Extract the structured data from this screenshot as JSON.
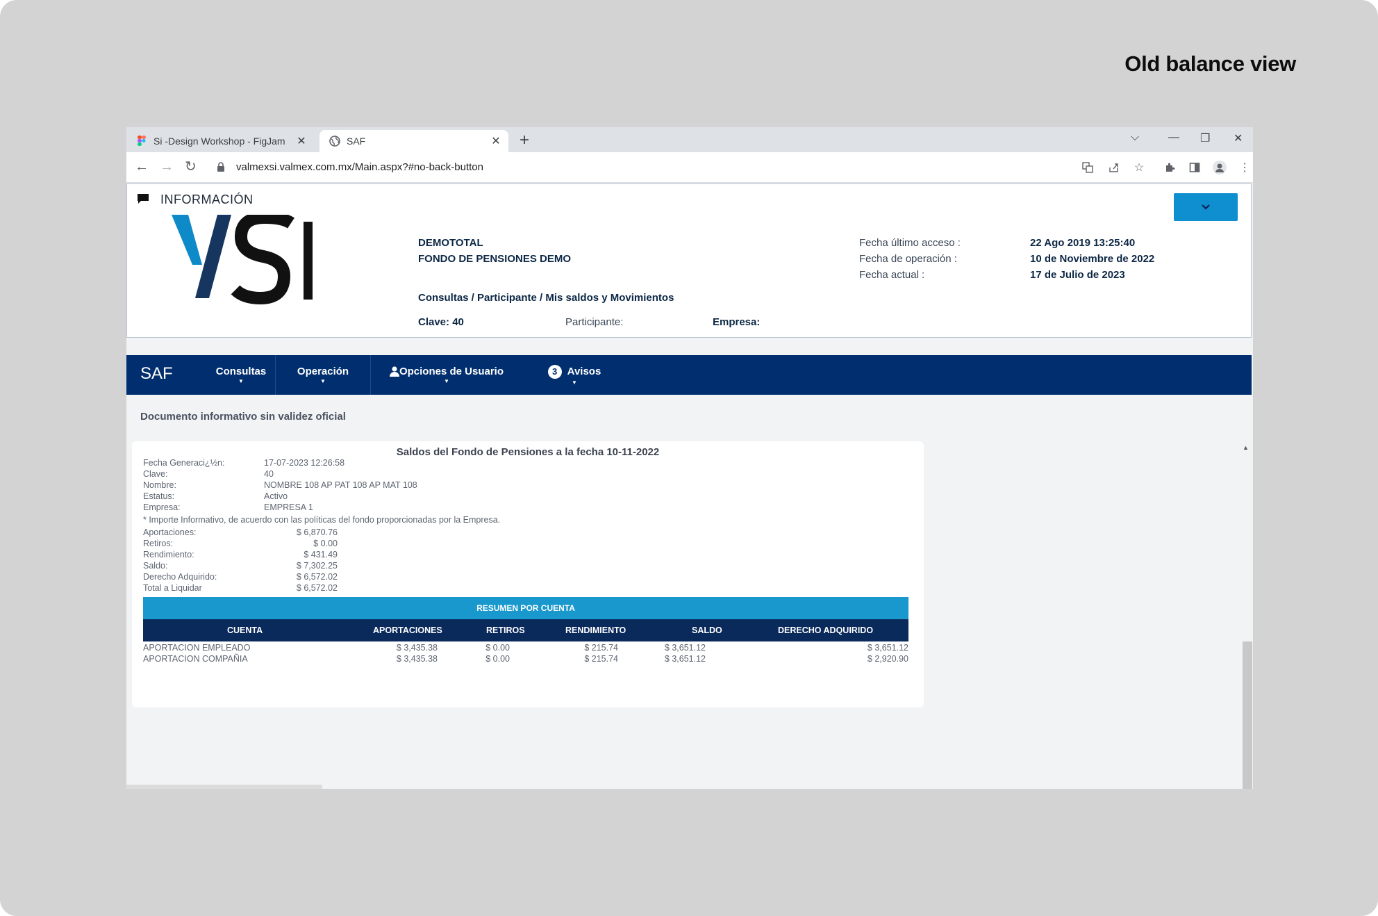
{
  "frame_title": "Old balance view",
  "browser": {
    "tabs": [
      {
        "label": "Si -Design Workshop - FigJam",
        "icon": "figma-icon"
      },
      {
        "label": "SAF",
        "icon": "globe-icon"
      }
    ],
    "url": "valmexsi.valmex.com.mx/Main.aspx?#no-back-button"
  },
  "header": {
    "section_title": "INFORMACIÓN",
    "org_line1": "DEMOTOTAL",
    "org_line2": "FONDO DE PENSIONES DEMO",
    "breadcrumb": "Consultas / Participante / Mis saldos y Movimientos",
    "clave_label": "Clave: 40",
    "participante_label": "Participante:",
    "empresa_label": "Empresa:",
    "fecha_ultimo_acceso_label": "Fecha último acceso :",
    "fecha_ultimo_acceso_value": "22 Ago 2019 13:25:40",
    "fecha_operacion_label": "Fecha de operación :",
    "fecha_operacion_value": "10 de Noviembre de 2022",
    "fecha_actual_label": "Fecha actual :",
    "fecha_actual_value": "17 de Julio de 2023",
    "accent_color": "#0f8ed0"
  },
  "nav": {
    "brand": "SAF",
    "items": [
      "Consultas",
      "Operación",
      "Opciones de Usuario",
      "Avisos"
    ],
    "avisos_count": "3",
    "bg_color": "#002e6e"
  },
  "notice": "Documento informativo sin validez oficial",
  "report": {
    "title": "Saldos del Fondo de Pensiones a la fecha 10-11-2022",
    "info": [
      {
        "label": "Fecha Generaci¿½n:",
        "value": "17-07-2023 12:26:58"
      },
      {
        "label": "Clave:",
        "value": "40"
      },
      {
        "label": "Nombre:",
        "value": "NOMBRE 108 AP PAT 108 AP MAT 108"
      },
      {
        "label": "Estatus:",
        "value": "Activo"
      },
      {
        "label": "Empresa:",
        "value": "EMPRESA 1"
      }
    ],
    "note": "* Importe Informativo, de acuerdo con las políticas del fondo proporcionadas por la Empresa.",
    "amounts": [
      {
        "label": "Aportaciones:",
        "value": "$ 6,870.76"
      },
      {
        "label": "Retiros:",
        "value": "$ 0.00"
      },
      {
        "label": "Rendimiento:",
        "value": "$ 431.49"
      },
      {
        "label": "Saldo:",
        "value": "$ 7,302.25"
      },
      {
        "label": "Derecho Adquirido:",
        "value": "$ 6,572.02"
      },
      {
        "label": "Total a Liquidar",
        "value": "$ 6,572.02"
      }
    ],
    "summary_title": "RESUMEN POR CUENTA",
    "columns": [
      "CUENTA",
      "APORTACIONES",
      "RETIROS",
      "RENDIMIENTO",
      "SALDO",
      "DERECHO ADQUIRIDO"
    ],
    "rows": [
      [
        "APORTACION EMPLEADO",
        "$ 3,435.38",
        "$ 0.00",
        "$ 215.74",
        "$ 3,651.12",
        "$ 3,651.12"
      ],
      [
        "APORTACION COMPAÑIA",
        "$ 3,435.38",
        "$ 0.00",
        "$ 215.74",
        "$ 3,651.12",
        "$ 2,920.90"
      ]
    ],
    "band_color": "#1898cc",
    "header_color": "#0a2a5c"
  }
}
